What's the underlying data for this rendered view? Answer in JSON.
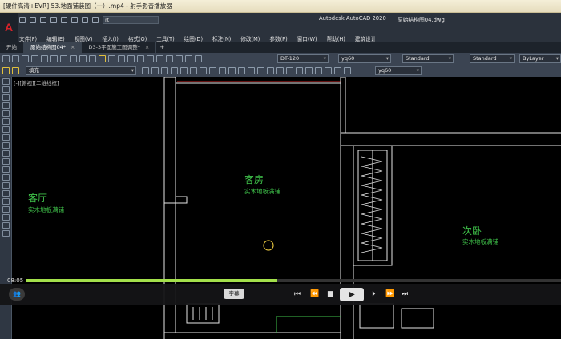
{
  "player": {
    "title": "[硬件高清+EVR] 53.地面铺装图（一）.mp4 - 射手影音播放器",
    "time": "08:05",
    "progress": 0.47,
    "subtitle_button": "字幕",
    "accent": "#a3e04b"
  },
  "acad": {
    "logo": "A",
    "workspace": "rt",
    "app_title": "Autodesk AutoCAD 2020",
    "file_title": "原始结构图04.dwg",
    "menu": [
      "文件(F)",
      "编辑(E)",
      "视图(V)",
      "插入(I)",
      "格式(O)",
      "工具(T)",
      "绘图(D)",
      "标注(N)",
      "修改(M)",
      "参数(P)",
      "窗口(W)",
      "帮助(H)",
      "建筑设计"
    ],
    "tabs": [
      "开始",
      "原始结构图04*",
      "D3-3平面施工图调整*"
    ],
    "toolbar": {
      "dimstyle": "DT-120",
      "textstyle": "yq60",
      "style1": "Standard",
      "style2": "Standard",
      "bylayer": "ByLayer",
      "layer": "填充",
      "layer2": "yq60"
    },
    "viewport_label": "[-][俯视][二维线框]"
  },
  "drawing": {
    "rooms": [
      {
        "name": "客厅",
        "floor": "实木地板满铺"
      },
      {
        "name": "客房",
        "floor": "实木地板满铺"
      },
      {
        "name": "次卧",
        "floor": "实木地板满铺"
      }
    ],
    "line_color": "#e6e6e6",
    "label_color": "#3fc24a"
  }
}
